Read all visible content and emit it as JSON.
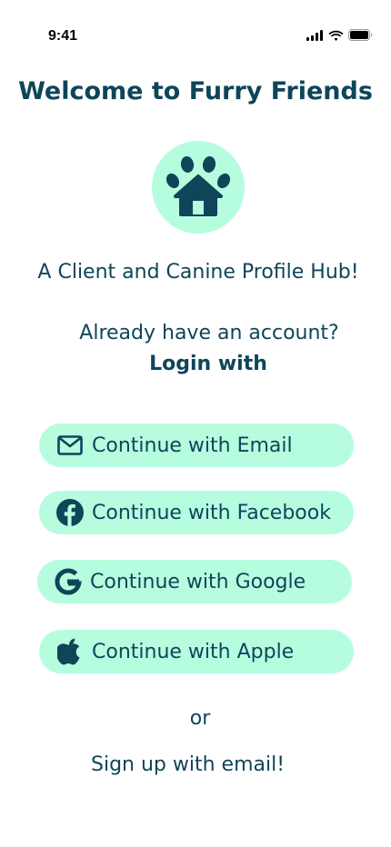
{
  "status_bar": {
    "time": "9:41"
  },
  "header": {
    "title": "Welcome to Furry Friends"
  },
  "logo": {
    "icon": "paw-house-icon"
  },
  "tagline": "A Client and Canine Profile Hub!",
  "login": {
    "prompt": "Already have an account?",
    "label": "Login with"
  },
  "buttons": [
    {
      "label": "Continue with Email",
      "icon": "mail-icon"
    },
    {
      "label": "Continue with Facebook",
      "icon": "facebook-icon"
    },
    {
      "label": "Continue with Google",
      "icon": "google-icon"
    },
    {
      "label": "Continue with Apple",
      "icon": "apple-icon"
    }
  ],
  "divider_text": "or",
  "signup": {
    "label": "Sign up with email!"
  },
  "colors": {
    "primary_text": "#0e4559",
    "button_bg": "#b6fde0",
    "background": "#ffffff"
  }
}
